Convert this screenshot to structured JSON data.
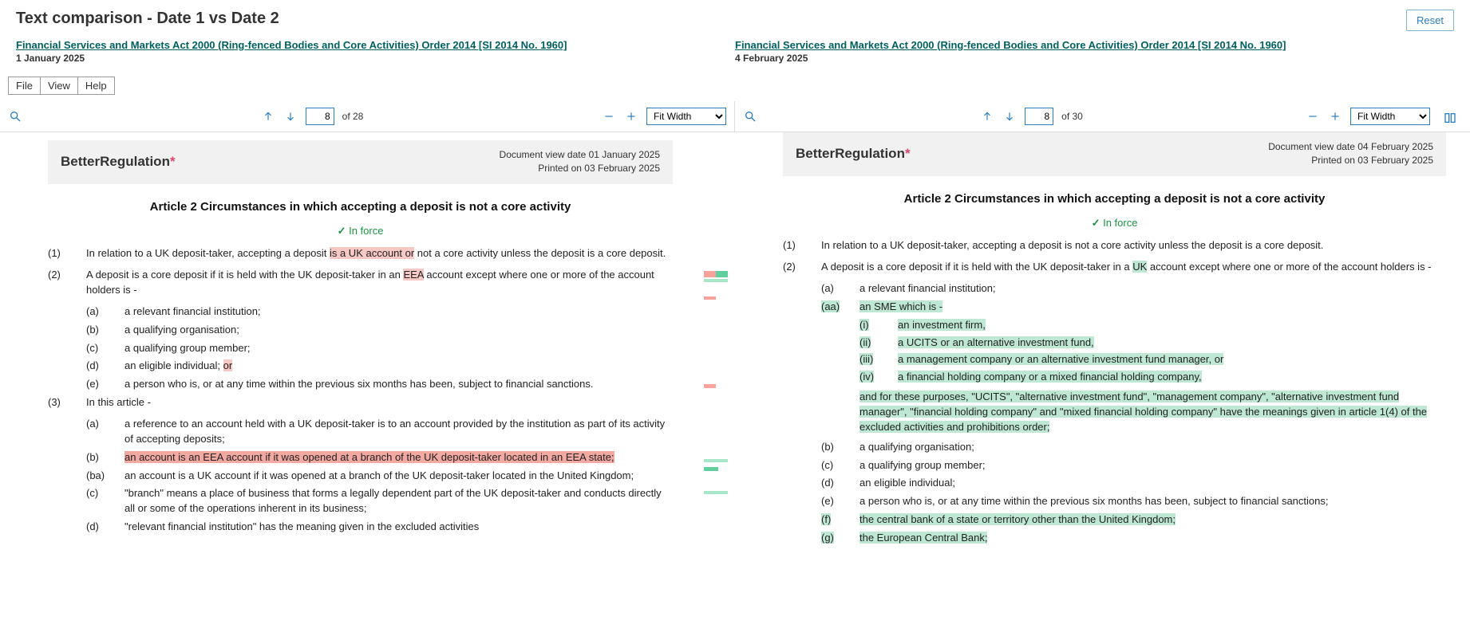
{
  "header": {
    "title": "Text comparison - Date 1 vs Date 2",
    "reset": "Reset"
  },
  "menubar": [
    "File",
    "View",
    "Help"
  ],
  "left_doc": {
    "link": "Financial Services and Markets Act 2000 (Ring-fenced Bodies and Core Activities) Order 2014 [SI 2014 No. 1960]",
    "date": "1 January 2025",
    "toolbar": {
      "page": "8",
      "total": "of 28",
      "zoom": "Fit Width"
    },
    "brand": "BetterRegulation",
    "view_date": "Document view date 01 January 2025",
    "printed": "Printed on 03 February 2025",
    "article_title": "Article 2 Circumstances in which accepting a deposit is not a core activity",
    "inforce": "In force",
    "p1_pre": "In relation to a UK deposit-taker, accepting a deposit ",
    "p1_hl": "is a UK account or",
    "p1_post": " not a core activity unless the deposit is a core deposit.",
    "p2_pre": "A deposit is a core deposit if it is held with the UK deposit-taker in an ",
    "p2_hl": "EEA",
    "p2_post": " account except where one or more of the account holders is -",
    "p2a": "a relevant financial institution;",
    "p2b": "a qualifying organisation;",
    "p2c": "a qualifying group member;",
    "p2d_pre": "an eligible individual; ",
    "p2d_hl": "or",
    "p2e": "a person who is, or at any time within the previous six months has been, subject to financial sanctions.",
    "p3": "In this article -",
    "p3a": "a reference to an account held with a UK deposit-taker is to an account provided by the institution as part of its activity of accepting deposits;",
    "p3b": "an account is an EEA account if it was opened at a branch of the UK deposit-taker located in an EEA state;",
    "p3ba": "an account is a UK account if it was opened at a branch of the UK deposit-taker located in the United Kingdom;",
    "p3c": "\"branch\" means a place of business that forms a legally dependent part of the UK deposit-taker and conducts directly all or some of the operations inherent in its business;",
    "p3d": "\"relevant financial institution\" has the meaning given in the excluded activities"
  },
  "right_doc": {
    "link": "Financial Services and Markets Act 2000 (Ring-fenced Bodies and Core Activities) Order 2014 [SI 2014 No. 1960]",
    "date": "4 February 2025",
    "toolbar": {
      "page": "8",
      "total": "of 30",
      "zoom": "Fit Width"
    },
    "brand": "BetterRegulation",
    "view_date": "Document view date 04 February 2025",
    "printed": "Printed on 03 February 2025",
    "article_title": "Article 2 Circumstances in which accepting a deposit is not a core activity",
    "inforce": "In force",
    "p1": "In relation to a UK deposit-taker, accepting a deposit is not a core activity unless the deposit is a core deposit.",
    "p2_pre": "A deposit is a core deposit if it is held with the UK deposit-taker in a ",
    "p2_hl": "UK",
    "p2_post": " account except where one or more of the account holders is -",
    "p2a": "a relevant financial institution;",
    "p2aa": "an SME which is -",
    "p2aa_i": "an investment firm,",
    "p2aa_ii": "a UCITS or an alternative investment fund,",
    "p2aa_iii": "a management company or an alternative investment fund manager, or",
    "p2aa_iv": "a financial holding company or a mixed financial holding company,",
    "p2aa_note": "and for these purposes, \"UCITS\", \"alternative investment fund\", \"management company\", \"alternative investment fund manager\", \"financial holding company\" and \"mixed financial holding company\" have the meanings given in article 1(4) of the excluded activities and prohibitions order;",
    "p2b": "a qualifying organisation;",
    "p2c": "a qualifying group member;",
    "p2d": "an eligible individual;",
    "p2e": "a person who is, or at any time within the previous six months has been, subject to financial sanctions;",
    "p2f": "the central bank of a state or territory other than the United Kingdom;",
    "p2g": "the European Central Bank;"
  }
}
